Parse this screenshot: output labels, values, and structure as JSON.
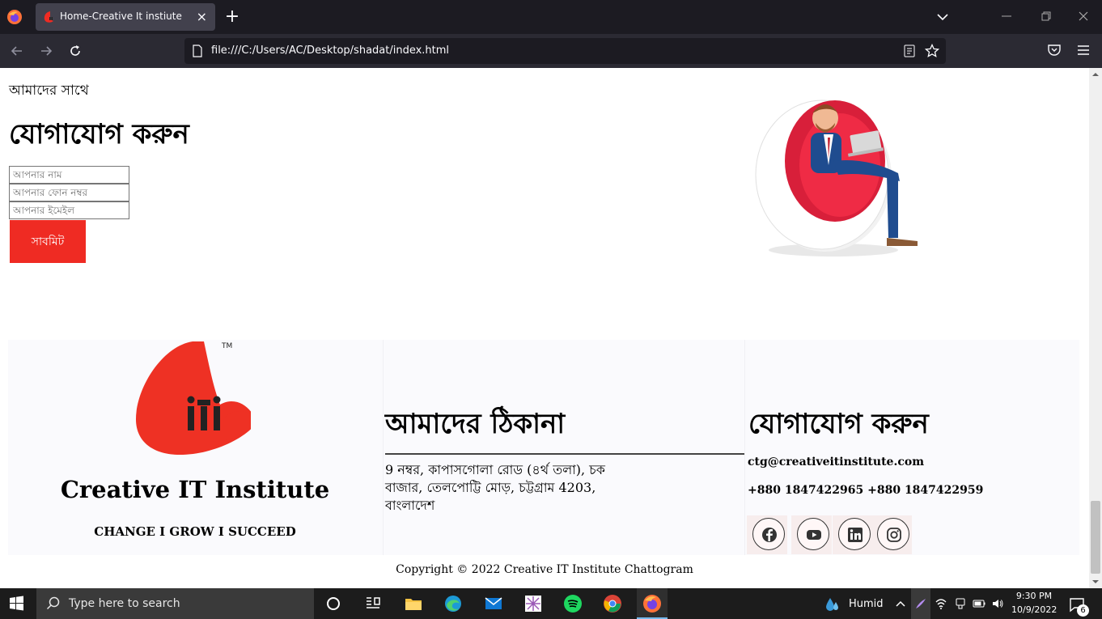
{
  "browser": {
    "tab_title": "Home-Creative It instiute",
    "tab_close": "×",
    "new_tab": "+",
    "url": "file:///C:/Users/AC/Desktop/shadat/index.html"
  },
  "contact": {
    "kicker": "আমাদের সাথে",
    "heading": "যোগাযোগ করুন",
    "name_placeholder": "আপনার নাম",
    "phone_placeholder": "আপনার ফোন নম্বর",
    "email_placeholder": "আপনার ইমেইল",
    "submit_label": "সাবমিট"
  },
  "footer": {
    "brand_name": "Creative IT Institute",
    "tagline": "CHANGE I GROW I SUCCEED",
    "address_heading": "আমাদের ঠিকানা",
    "address_text": "9 নম্বর, কাপাসগোলা রোড (৪র্থ তলা), চক বাজার, তেলপোট্টি মোড়, চট্টগ্রাম 4203, বাংলাদেশ",
    "contact_heading": "যোগাযোগ করুন",
    "email": "ctg@creativeitinstitute.com",
    "phones": "+880 1847422965 +880 1847422959",
    "social": [
      "facebook-icon",
      "youtube-icon",
      "linkedin-icon",
      "instagram-icon"
    ],
    "copyright": "Copyright © 2022 Creative IT Institute Chattogram"
  },
  "colors": {
    "brand_red": "#ef2b23",
    "chrome_dark": "#1c1b22",
    "taskbar": "#1c1c1c"
  },
  "taskbar": {
    "search_placeholder": "Type here to search",
    "weather": "Humid",
    "time": "9:30 PM",
    "date": "10/9/2022",
    "notification_count": "6"
  }
}
